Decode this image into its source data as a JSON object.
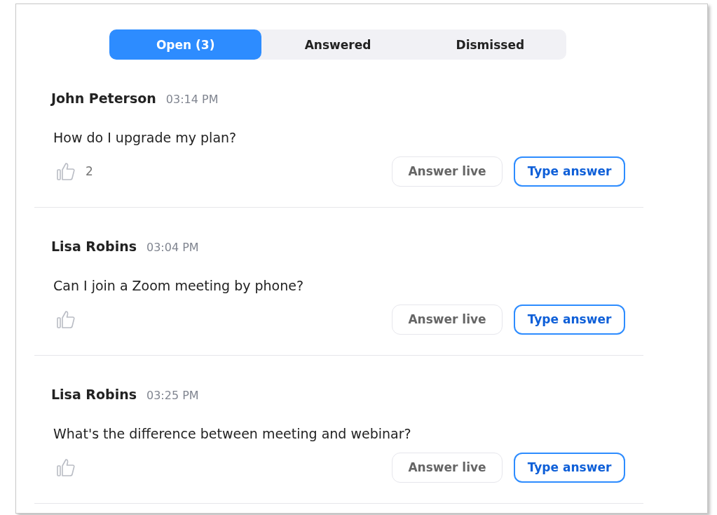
{
  "tabs": [
    {
      "label": "Open (3)",
      "selected": true
    },
    {
      "label": "Answered",
      "selected": false
    },
    {
      "label": "Dismissed",
      "selected": false
    }
  ],
  "questions": [
    {
      "name": "John Peterson",
      "time": "03:14 PM",
      "text": "How do I upgrade my plan?",
      "likes": "2",
      "buttons": [
        "Answer live",
        "Type answer"
      ]
    },
    {
      "name": "Lisa Robins",
      "time": "03:04 PM",
      "text": "Can I join a Zoom meeting by phone?",
      "buttons": [
        "Answer live",
        "Type answer"
      ]
    },
    {
      "name": "Lisa Robins",
      "time": "03:25 PM",
      "text": "What's the difference between meeting and webinar?",
      "buttons": [
        "Answer live",
        "Type answer"
      ]
    }
  ]
}
